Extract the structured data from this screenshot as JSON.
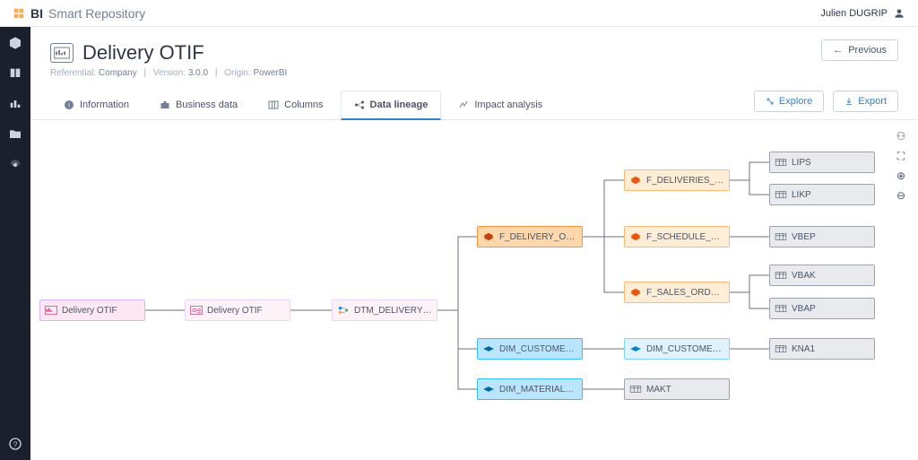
{
  "brand": {
    "bold": "BI",
    "light": "Smart Repository"
  },
  "user": {
    "name": "Julien DUGRIP"
  },
  "header": {
    "title": "Delivery OTIF",
    "previous_label": "Previous",
    "meta": {
      "referential_label": "Referential:",
      "referential_value": "Company",
      "version_label": "Version:",
      "version_value": "3.0.0",
      "origin_label": "Origin:",
      "origin_value": "PowerBI"
    }
  },
  "tabs": {
    "information": "Information",
    "business_data": "Business data",
    "columns": "Columns",
    "data_lineage": "Data lineage",
    "impact_analysis": "Impact analysis"
  },
  "actions": {
    "explore": "Explore",
    "export": "Export"
  },
  "nodes": {
    "n1": "Delivery OTIF",
    "n2": "Delivery OTIF",
    "n3": "DTM_DELIVERY_OTIF_...",
    "n4": "F_DELIVERY_OTIF_RV",
    "n5": "DIM_CUSTOMER_SD_...",
    "n6": "DIM_MATERIAL_RV",
    "n7": "F_DELIVERIES_RV",
    "n8": "F_SCHEDULE_LINE_...",
    "n9": "F_SALES_ORDER_RV",
    "n10": "DIM_CUSTOMER_RV",
    "n11": "MAKT",
    "n12": "LIPS",
    "n13": "LIKP",
    "n14": "VBEP",
    "n15": "VBAK",
    "n16": "VBAP",
    "n17": "KNA1"
  }
}
